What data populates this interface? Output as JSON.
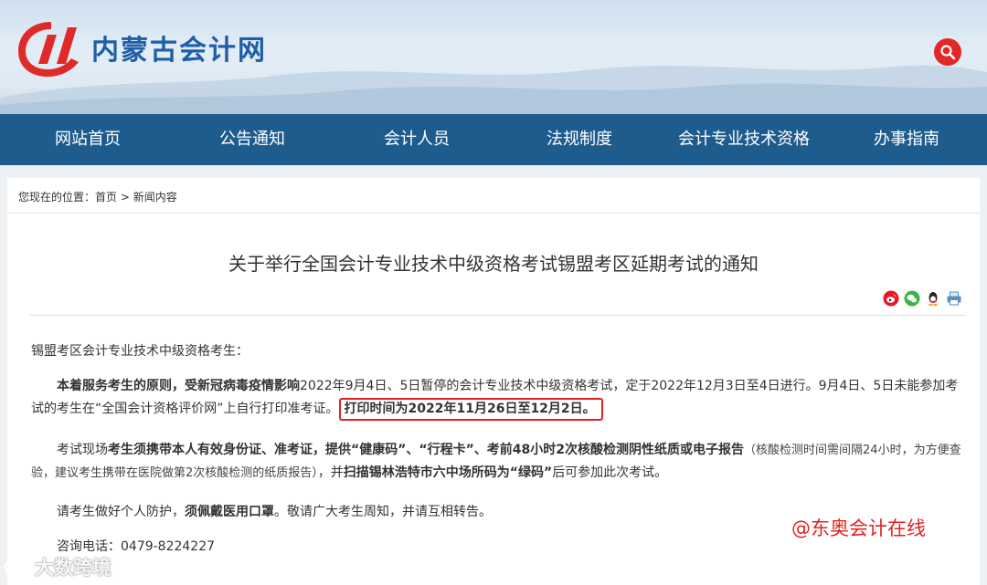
{
  "header": {
    "site_name": "内蒙古会计网",
    "logo_icon": "nmg-accounting-logo",
    "search_icon": "search-icon",
    "brand_color": "#1e5fa8",
    "accent_color": "#e32626"
  },
  "nav": {
    "items": [
      {
        "label": "网站首页"
      },
      {
        "label": "公告通知"
      },
      {
        "label": "会计人员"
      },
      {
        "label": "法规制度"
      },
      {
        "label": "会计专业技术资格"
      },
      {
        "label": "办事指南"
      }
    ],
    "bg_color": "#1f5c8e"
  },
  "breadcrumb": {
    "prefix": "您现在的位置：",
    "home": "首页",
    "sep": " > ",
    "current": "新闻内容"
  },
  "article": {
    "title": "关于举行全国会计专业技术中级资格考试锡盟考区延期考试的通知",
    "share_icons": [
      "weibo-icon",
      "wechat-icon",
      "qq-icon",
      "print-icon"
    ],
    "greeting": "锡盟考区会计专业技术中级资格考生：",
    "p1": {
      "bold1": "本着服务考生的原则，受新冠病毒疫情影响",
      "text1": "2022年9月4日、5日暂停的会计专业技术中级资格考试，定于2022年12月3日至4日进行。9月4日、5日未能参加考试的考生在“全国会计资格评价网”上自行打印准考证。",
      "highlight": "打印时间为2022年11月26日至12月2日。"
    },
    "p2": {
      "text1": "考试现场",
      "bold1": "考生须携带本人有效身份证、准考证，提供“健康码”、“行程卡”、考前48小时2次核酸检测阴性纸质或电子报告",
      "small1": "（核酸检测时间需间隔24小时，为方便查验，建议考生携带在医院做第2次核酸检测的纸质报告）",
      "text2": "，并",
      "bold2": "扫描锡林浩特市六中场所码为“绿码”",
      "text3": "后可参加此次考试。"
    },
    "p3": {
      "text1": "请考生做好个人防护，",
      "bold1": "须佩戴医用口罩",
      "text2": "。敬请广大考生周知，并请互相转告。"
    },
    "p4": {
      "text1": "咨询电话：0479-8224227"
    }
  },
  "watermarks": {
    "right": "@东奥会计在线",
    "left": "大数跨境"
  }
}
